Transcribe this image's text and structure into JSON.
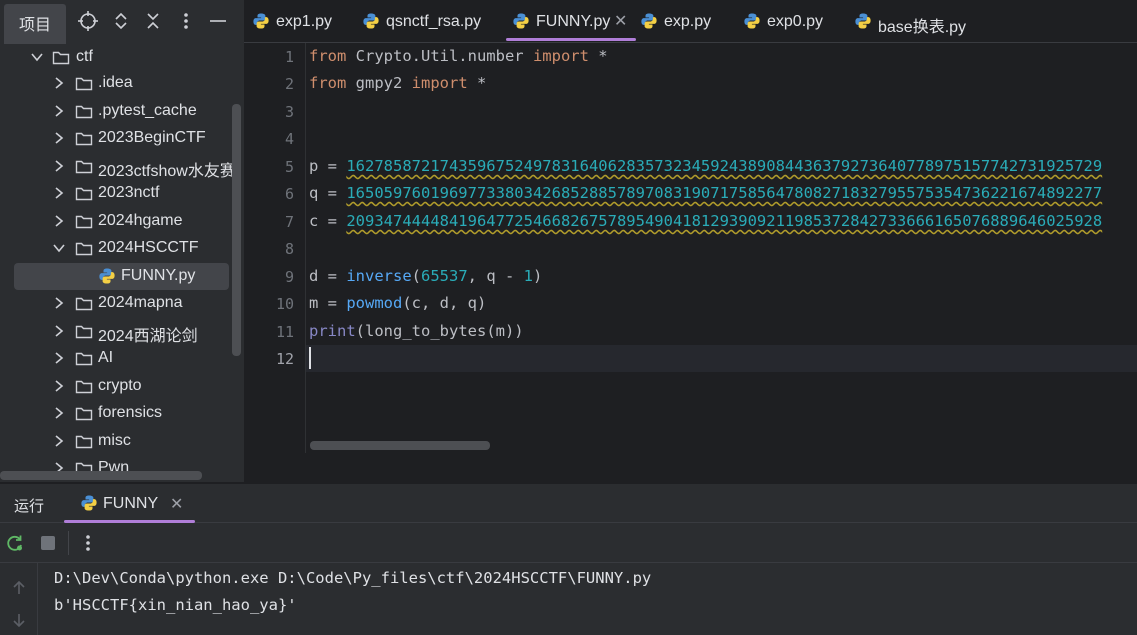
{
  "project_panel": {
    "title": "项目",
    "tree": [
      {
        "label": "ctf",
        "expanded": true
      },
      {
        "label": ".idea"
      },
      {
        "label": ".pytest_cache"
      },
      {
        "label": "2023BeginCTF"
      },
      {
        "label": "2023ctfshow水友赛"
      },
      {
        "label": "2023nctf"
      },
      {
        "label": "2024hgame"
      },
      {
        "label": "2024HSCCTF",
        "expanded": true
      },
      {
        "label": "FUNNY.py",
        "selected": true
      },
      {
        "label": "2024mapna"
      },
      {
        "label": "2024西湖论剑"
      },
      {
        "label": "AI"
      },
      {
        "label": "crypto"
      },
      {
        "label": "forensics"
      },
      {
        "label": "misc"
      },
      {
        "label": "Pwn"
      }
    ]
  },
  "tabs": [
    {
      "label": "exp1.py"
    },
    {
      "label": "qsnctf_rsa.py"
    },
    {
      "label": "FUNNY.py",
      "active": true,
      "close": "✕"
    },
    {
      "label": "exp.py"
    },
    {
      "label": "exp0.py"
    },
    {
      "label": "base换表.py"
    }
  ],
  "editor": {
    "line_numbers": [
      "1",
      "2",
      "3",
      "4",
      "5",
      "6",
      "7",
      "8",
      "9",
      "10",
      "11",
      "12"
    ],
    "current_line": "12",
    "code": {
      "l1": {
        "kw1": "from",
        "mod": " Crypto.Util.number ",
        "kw2": "import",
        "rest": " *"
      },
      "l2": {
        "kw1": "from",
        "mod": " gmpy2 ",
        "kw2": "import",
        "rest": " *"
      },
      "l5": {
        "var": "p = ",
        "val": "162785872174359675249783164062835732345924389084436379273640778975157742731925729"
      },
      "l6": {
        "var": "q = ",
        "val": "165059760196977338034268528857897083190717585647808271832795575354736221674892277"
      },
      "l7": {
        "var": "c = ",
        "val": "209347444484196477254668267578954904181293909211985372842733666165076889646025928"
      },
      "l9": {
        "var": "d = ",
        "fn": "inverse",
        "open": "(",
        "num1": "65537",
        "mid": ", q - ",
        "num2": "1",
        "close": ")"
      },
      "l10": {
        "var": "m = ",
        "fn": "powmod",
        "args": "(c, d, q)"
      },
      "l11": {
        "fn": "print",
        "args": "(long_to_bytes(m))"
      }
    }
  },
  "run_panel": {
    "title": "运行",
    "tab_label": "FUNNY",
    "tab_close": "✕",
    "console": [
      "D:\\Dev\\Conda\\python.exe D:\\Code\\Py_files\\ctf\\2024HSCCTF\\FUNNY.py",
      "b'HSCCTF{xin_nian_hao_ya}'"
    ]
  },
  "colors": {
    "accent": "#b07ed8",
    "keyword": "#cf8e6d",
    "number": "#2aacb8",
    "function": "#56a8f5",
    "builtin": "#8888c6"
  }
}
